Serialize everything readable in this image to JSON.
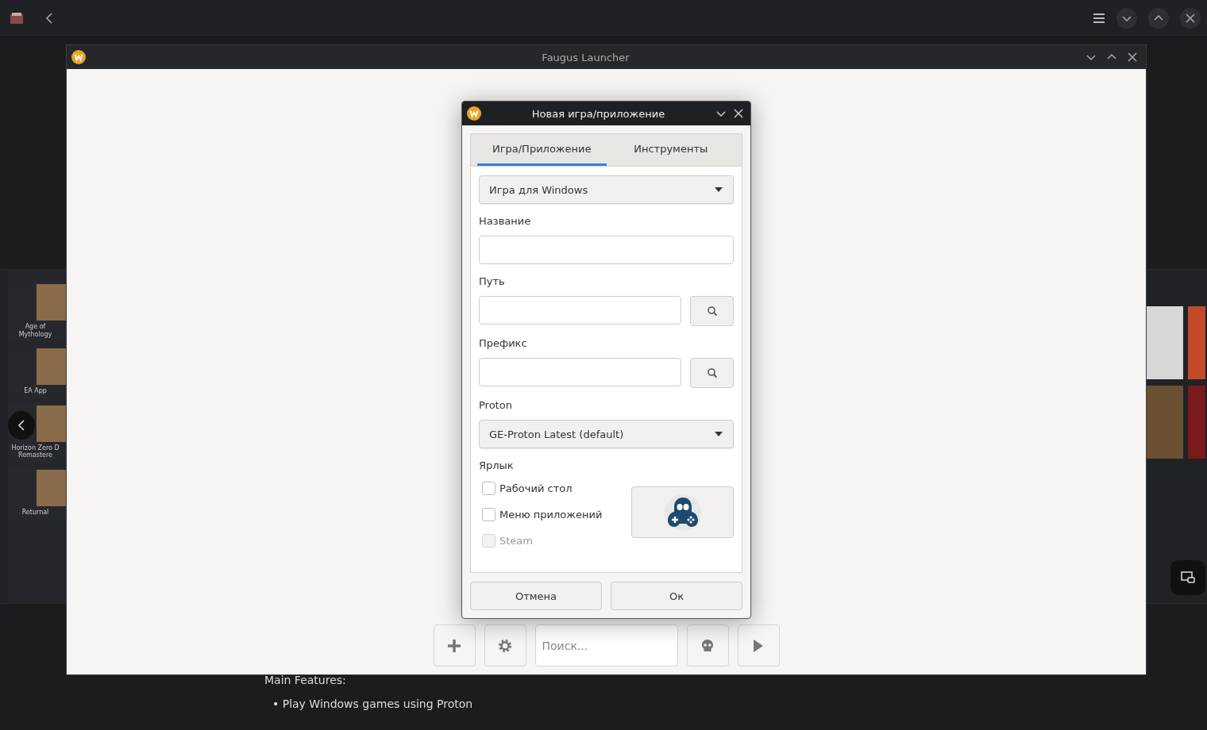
{
  "library": {
    "left_tiles": [
      {
        "label": "Age of Mythology"
      },
      {
        "label": "EA App"
      },
      {
        "label": "Horizon Zero D Remastere"
      },
      {
        "label": "Returnal"
      }
    ]
  },
  "features": {
    "heading": "Main Features:",
    "items": [
      "• Play Windows games using Proton"
    ]
  },
  "window": {
    "title": "Faugus Launcher"
  },
  "dialog": {
    "title": "Новая игра/приложение",
    "tabs": [
      {
        "label": "Игра/Приложение",
        "selected": true
      },
      {
        "label": "Инструменты",
        "selected": false
      }
    ],
    "game_type": "Игра для Windows",
    "fields": [
      {
        "label": "Название",
        "kind": "text"
      },
      {
        "label": "Путь",
        "kind": "browse"
      },
      {
        "label": "Префикс",
        "kind": "browse"
      }
    ],
    "proton": {
      "label": "Proton",
      "value": "GE-Proton Latest (default)"
    },
    "shortcut": {
      "label": "Ярлык",
      "options": [
        {
          "label": "Рабочий стол",
          "checked": false,
          "disabled": false
        },
        {
          "label": "Меню приложений",
          "checked": false,
          "disabled": false
        },
        {
          "label": "Steam",
          "checked": false,
          "disabled": true
        }
      ]
    },
    "buttons": [
      "Отмена",
      "Ок"
    ]
  },
  "toolbar": {
    "search_placeholder": "Поиск..."
  }
}
